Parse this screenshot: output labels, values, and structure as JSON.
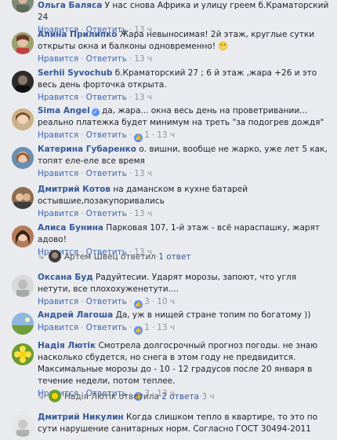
{
  "labels": {
    "like": "Нравится",
    "reply": "Ответить",
    "dot": "·"
  },
  "comments": [
    {
      "author": "Ольга Баляса",
      "text": "У нас снова Африка и улицу греем б.Краматорский 24",
      "likes": "",
      "time": "13 ч"
    },
    {
      "author": "Алина Прилипко",
      "text": "Жара невыносимая! 2й этаж, круглые сутки открыты окна и балконы одновременно! 😬",
      "likes": "",
      "time": "13 ч"
    },
    {
      "author": "Serhii Syvochub",
      "text": "б.Краматорский 27 ; 6 й этаж ,жара +26 и это весь день форточка открыта.",
      "likes": "",
      "time": "13 ч"
    },
    {
      "author": "Sima Angel",
      "text": "да, жара... окна весь день на проветривании... реально платежка будет минимум на треть \"за подогрев дождя\"",
      "likes": "1",
      "time": "13 ч"
    },
    {
      "author": "Катерина Губаренко",
      "text": "о. вишни, вообще не жарко, уже лет 5 как, топят еле-еле все время",
      "likes": "",
      "time": "13 ч"
    },
    {
      "author": "Дмитрий Котов",
      "text": "на даманском в кухне батарей остывшие,позакупоривались",
      "likes": "",
      "time": "13 ч"
    },
    {
      "author": "Алиса Бунина",
      "text": "Парковая 107, 1-й этаж - всё нараспашку, жарят адово!",
      "likes": "",
      "time": "13 ч"
    },
    {
      "author": "Оксана Буд",
      "text": "Радуйтесии. Ударят морозы, запоют, что угля нетути, все плохохуженетути....",
      "likes": "3",
      "time": "10 ч"
    },
    {
      "author": "Андрей Лагоша",
      "text": "Да, уж в нищей стране топим по богатому ))",
      "likes": "1",
      "time": "13 ч"
    },
    {
      "author": "Надія Лютік",
      "text": "Смотрела долгосрочный прогноз погоды. не знаю насколько сбудется, но снега в этом году не предвидится. Максимальные морозы до - 10 - 12 градусов после 20 января в течение недели, потом теплее.",
      "likes": "3",
      "time": "13 ч"
    },
    {
      "author": "Дмитрий Никулин",
      "text": "Когда слишком тепло в квартире, то это по сути нарушение санитарных норм. Согласно ГОСТ 30494-2011",
      "likes": "",
      "time": ""
    }
  ],
  "replies": [
    {
      "name": "Артем Швец ответил",
      "count": "1 ответ",
      "time": ""
    },
    {
      "name": "Надія Лютік ответила",
      "count": "2 ответа",
      "time": "3 ч"
    }
  ]
}
